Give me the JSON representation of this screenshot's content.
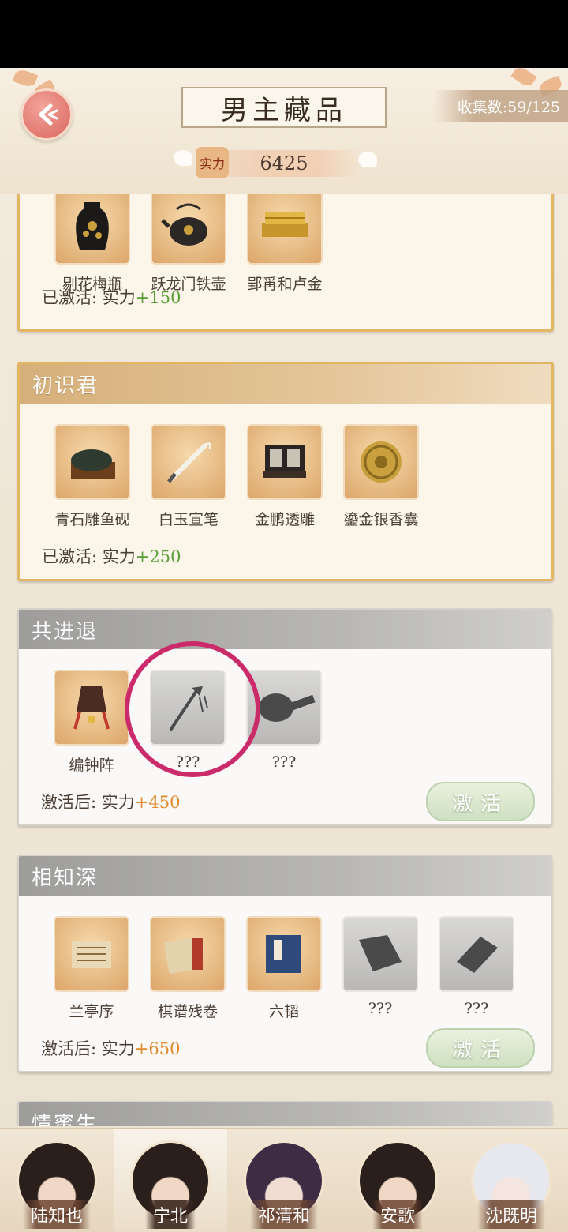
{
  "header": {
    "title": "男主藏品",
    "collect_label": "收集数:59/125",
    "power_label": "实力",
    "power_value": "6425"
  },
  "sections": [
    {
      "title": "",
      "items": [
        "剔花梅瓶",
        "跃龙门铁壶",
        "郢爯和卢金"
      ],
      "status_text": "已激活: 实力",
      "bonus": "+150"
    },
    {
      "title": "初识君",
      "items": [
        "青石雕鱼砚",
        "白玉宣笔",
        "金鹏透雕",
        "鎏金银香囊"
      ],
      "status_text": "已激活: 实力",
      "bonus": "+250"
    },
    {
      "title": "共进退",
      "items": [
        "编钟阵",
        "???",
        "???"
      ],
      "status_text": "激活后: 实力",
      "bonus": "+450",
      "button": "激活"
    },
    {
      "title": "相知深",
      "items": [
        "兰亭序",
        "棋谱残卷",
        "六韬",
        "???",
        "???"
      ],
      "status_text": "激活后: 实力",
      "bonus": "+650",
      "button": "激活"
    },
    {
      "title": "情蜜生"
    }
  ],
  "tabs": [
    "陆知也",
    "宁北",
    "祁清和",
    "安歌",
    "沈既明"
  ],
  "colors": {
    "gold_border": "#e2b763",
    "gray_header": "#b8b7b4",
    "green_bonus": "#5a9e3a",
    "orange_bonus": "#e08a2c",
    "annotation_circle": "#cc2b6b"
  }
}
